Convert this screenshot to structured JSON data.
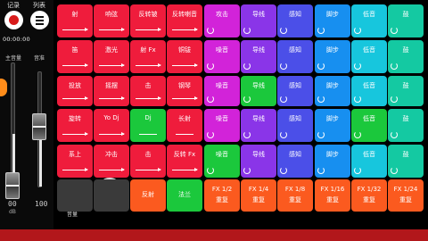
{
  "top": {
    "record_label": "记录",
    "list_label": "列表",
    "timer": "00:00:00"
  },
  "volume": {
    "master_label": "主音量",
    "track_label": "音准",
    "master_level": 0.0,
    "track_level": 0.52,
    "master_value": "00",
    "track_value": "100",
    "db_label": "dB"
  },
  "controls": {
    "mixer_label": "音量",
    "knob_value": "1"
  },
  "colors": {
    "red": "#ef1c3c",
    "orange": "#fb5a1f",
    "green": "#1bc83c",
    "magenta": "#d223d9",
    "purple": "#8a35e8",
    "indigo": "#4b4fe8",
    "blue": "#178ff0",
    "cyan": "#17c6dd",
    "teal": "#14c9a2",
    "grey": "#3a3a3a"
  },
  "pads": [
    [
      {
        "label": "射",
        "mark": "arrow",
        "color": "red"
      },
      {
        "label": "响弦",
        "mark": "arrow",
        "color": "red"
      },
      {
        "label": "反转铍",
        "mark": "arrow",
        "color": "red"
      },
      {
        "label": "反转喇音",
        "mark": "arrow",
        "color": "red"
      },
      {
        "label": "攻击",
        "mark": "loop",
        "color": "magenta"
      },
      {
        "label": "导线",
        "mark": "loop",
        "color": "purple"
      },
      {
        "label": "感知",
        "mark": "loop",
        "color": "indigo"
      },
      {
        "label": "脚步",
        "mark": "loop",
        "color": "blue"
      },
      {
        "label": "低音",
        "mark": "loop",
        "color": "cyan"
      },
      {
        "label": "鼓",
        "mark": "loop",
        "color": "teal"
      }
    ],
    [
      {
        "label": "笛",
        "mark": "arrow",
        "color": "red"
      },
      {
        "label": "激光",
        "mark": "arrow",
        "color": "red"
      },
      {
        "label": "射 Fx",
        "mark": "arrow",
        "color": "red"
      },
      {
        "label": "铜钹",
        "mark": "arrow",
        "color": "red"
      },
      {
        "label": "噪音",
        "mark": "loop",
        "color": "magenta"
      },
      {
        "label": "导线",
        "mark": "loop",
        "color": "purple"
      },
      {
        "label": "感知",
        "mark": "loop",
        "color": "indigo"
      },
      {
        "label": "脚步",
        "mark": "loop",
        "color": "blue"
      },
      {
        "label": "低音",
        "mark": "loop",
        "color": "cyan"
      },
      {
        "label": "鼓",
        "mark": "loop",
        "color": "teal"
      }
    ],
    [
      {
        "label": "投放",
        "mark": "arrow",
        "color": "red"
      },
      {
        "label": "摇摆",
        "mark": "arrow",
        "color": "red"
      },
      {
        "label": "击",
        "mark": "arrow",
        "color": "red"
      },
      {
        "label": "钢琴",
        "mark": "arrow",
        "color": "red"
      },
      {
        "label": "噪音",
        "mark": "loop",
        "color": "magenta"
      },
      {
        "label": "导线",
        "mark": "loop",
        "color": "green"
      },
      {
        "label": "感知",
        "mark": "loop",
        "color": "indigo"
      },
      {
        "label": "脚步",
        "mark": "loop",
        "color": "blue"
      },
      {
        "label": "低音",
        "mark": "loop",
        "color": "cyan"
      },
      {
        "label": "鼓",
        "mark": "loop",
        "color": "teal"
      }
    ],
    [
      {
        "label": "旋转",
        "mark": "arrow",
        "color": "red"
      },
      {
        "label": "Yo Dj",
        "mark": "arrow",
        "color": "red"
      },
      {
        "label": "Dj",
        "mark": "dash",
        "color": "green"
      },
      {
        "label": "长射",
        "mark": "dash",
        "color": "red"
      },
      {
        "label": "噪音",
        "mark": "loop",
        "color": "magenta"
      },
      {
        "label": "导线",
        "mark": "loop",
        "color": "purple"
      },
      {
        "label": "感知",
        "mark": "loop",
        "color": "indigo"
      },
      {
        "label": "脚步",
        "mark": "loop",
        "color": "blue"
      },
      {
        "label": "低音",
        "mark": "loop",
        "color": "green"
      },
      {
        "label": "鼓",
        "mark": "loop",
        "color": "teal"
      }
    ],
    [
      {
        "label": "系上",
        "mark": "arrow",
        "color": "red"
      },
      {
        "label": "冲击",
        "mark": "arrow",
        "color": "red"
      },
      {
        "label": "击",
        "mark": "arrow",
        "color": "red"
      },
      {
        "label": "反转 Fx",
        "mark": "arrow",
        "color": "red"
      },
      {
        "label": "噪音",
        "mark": "loop",
        "color": "green"
      },
      {
        "label": "导线",
        "mark": "loop",
        "color": "purple"
      },
      {
        "label": "感知",
        "mark": "loop",
        "color": "indigo"
      },
      {
        "label": "脚步",
        "mark": "loop",
        "color": "blue"
      },
      {
        "label": "低音",
        "mark": "loop",
        "color": "cyan"
      },
      {
        "label": "鼓",
        "mark": "loop",
        "color": "teal"
      }
    ]
  ],
  "bottom_pads": [
    {
      "label": "",
      "line2": "",
      "color": "grey"
    },
    {
      "label": "",
      "line2": "",
      "color": "grey"
    },
    {
      "label": "反射",
      "line2": "",
      "color": "orange"
    },
    {
      "label": "法兰",
      "line2": "",
      "color": "green"
    },
    {
      "label": "FX 1/2",
      "line2": "重复",
      "color": "orange"
    },
    {
      "label": "FX 1/4",
      "line2": "重复",
      "color": "orange"
    },
    {
      "label": "FX 1/8",
      "line2": "重复",
      "color": "orange"
    },
    {
      "label": "FX 1/16",
      "line2": "重复",
      "color": "orange"
    },
    {
      "label": "FX 1/32",
      "line2": "重复",
      "color": "orange"
    },
    {
      "label": "FX 1/24",
      "line2": "重复",
      "color": "orange"
    }
  ]
}
